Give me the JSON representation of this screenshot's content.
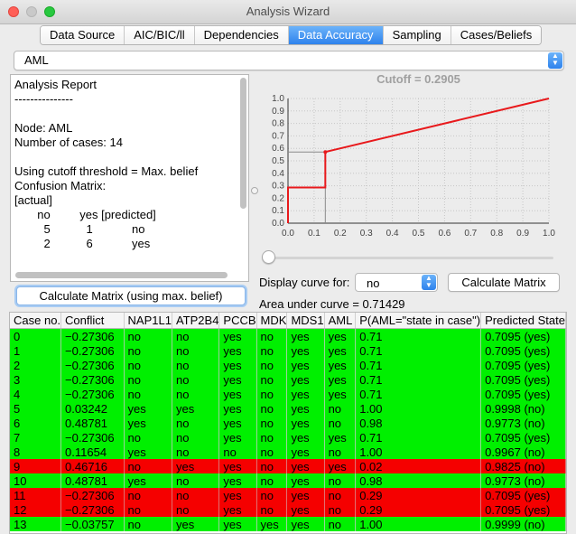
{
  "window": {
    "title": "Analysis Wizard"
  },
  "tabs": [
    {
      "label": "Data Source"
    },
    {
      "label": "AIC/BIC/ll"
    },
    {
      "label": "Dependencies"
    },
    {
      "label": "Data Accuracy",
      "active": true
    },
    {
      "label": "Sampling"
    },
    {
      "label": "Cases/Beliefs"
    }
  ],
  "node_select": {
    "value": "AML"
  },
  "report": {
    "lines": [
      "Analysis Report",
      "---------------",
      "",
      "Node: AML",
      "Number of cases: 14",
      "",
      "Using cutoff threshold = Max. belief",
      "Confusion Matrix:",
      "[actual]",
      "       no         yes [predicted]",
      "         5           1            no",
      "         2           6            yes"
    ]
  },
  "buttons": {
    "calc_max_belief": "Calculate Matrix (using max. belief)",
    "calc_matrix": "Calculate Matrix"
  },
  "chart": {
    "title": "Cutoff = 0.2905"
  },
  "chart_data": {
    "type": "line",
    "title": "Cutoff = 0.2905",
    "xlabel": "",
    "ylabel": "",
    "xlim": [
      0.0,
      1.0
    ],
    "ylim": [
      0.0,
      1.0
    ],
    "x_ticks": [
      "0.0",
      "0.1",
      "0.2",
      "0.3",
      "0.4",
      "0.5",
      "0.6",
      "0.7",
      "0.8",
      "0.9",
      "1.0"
    ],
    "y_ticks": [
      "0.0",
      "0.1",
      "0.2",
      "0.3",
      "0.4",
      "0.5",
      "0.6",
      "0.7",
      "0.8",
      "0.9",
      "1.0"
    ],
    "grid": true,
    "series": [
      {
        "x": [
          0.0,
          0.0,
          0.143,
          0.143,
          1.0
        ],
        "y": [
          0.0,
          0.286,
          0.286,
          0.571,
          1.0
        ]
      }
    ],
    "cutoff_marker": {
      "x": 0.143,
      "y": 0.571
    }
  },
  "slider": {
    "value": 0.0
  },
  "controls": {
    "display_curve_label": "Display curve for:",
    "display_curve_value": "no",
    "auc_label": "Area under curve = 0.71429"
  },
  "table": {
    "columns": [
      "Case no.",
      "Conflict",
      "NAP1L1",
      "ATP2B4",
      "PCCB",
      "MDK",
      "MDS1",
      "AML",
      "P(AML=\"state in case\")",
      "Predicted State"
    ],
    "rows": [
      {
        "cells": [
          "0",
          "−0.27306",
          "no",
          "no",
          "yes",
          "no",
          "yes",
          "yes",
          "0.71",
          "0.7095 (yes)"
        ],
        "status": "green"
      },
      {
        "cells": [
          "1",
          "−0.27306",
          "no",
          "no",
          "yes",
          "no",
          "yes",
          "yes",
          "0.71",
          "0.7095 (yes)"
        ],
        "status": "green"
      },
      {
        "cells": [
          "2",
          "−0.27306",
          "no",
          "no",
          "yes",
          "no",
          "yes",
          "yes",
          "0.71",
          "0.7095 (yes)"
        ],
        "status": "green"
      },
      {
        "cells": [
          "3",
          "−0.27306",
          "no",
          "no",
          "yes",
          "no",
          "yes",
          "yes",
          "0.71",
          "0.7095 (yes)"
        ],
        "status": "green"
      },
      {
        "cells": [
          "4",
          "−0.27306",
          "no",
          "no",
          "yes",
          "no",
          "yes",
          "yes",
          "0.71",
          "0.7095 (yes)"
        ],
        "status": "green"
      },
      {
        "cells": [
          "5",
          "0.03242",
          "yes",
          "yes",
          "yes",
          "no",
          "yes",
          "no",
          "1.00",
          "0.9998 (no)"
        ],
        "status": "green"
      },
      {
        "cells": [
          "6",
          "0.48781",
          "yes",
          "no",
          "yes",
          "no",
          "yes",
          "no",
          "0.98",
          "0.9773 (no)"
        ],
        "status": "green"
      },
      {
        "cells": [
          "7",
          "−0.27306",
          "no",
          "no",
          "yes",
          "no",
          "yes",
          "yes",
          "0.71",
          "0.7095 (yes)"
        ],
        "status": "green"
      },
      {
        "cells": [
          "8",
          "0.11654",
          "yes",
          "no",
          "no",
          "no",
          "yes",
          "no",
          "1.00",
          "0.9967 (no)"
        ],
        "status": "green"
      },
      {
        "cells": [
          "9",
          "0.46716",
          "no",
          "yes",
          "yes",
          "no",
          "yes",
          "yes",
          "0.02",
          "0.9825 (no)"
        ],
        "status": "red"
      },
      {
        "cells": [
          "10",
          "0.48781",
          "yes",
          "no",
          "yes",
          "no",
          "yes",
          "no",
          "0.98",
          "0.9773 (no)"
        ],
        "status": "green"
      },
      {
        "cells": [
          "11",
          "−0.27306",
          "no",
          "no",
          "yes",
          "no",
          "yes",
          "no",
          "0.29",
          "0.7095 (yes)"
        ],
        "status": "red"
      },
      {
        "cells": [
          "12",
          "−0.27306",
          "no",
          "no",
          "yes",
          "no",
          "yes",
          "no",
          "0.29",
          "0.7095 (yes)"
        ],
        "status": "red"
      },
      {
        "cells": [
          "13",
          "−0.03757",
          "no",
          "yes",
          "yes",
          "yes",
          "yes",
          "no",
          "1.00",
          "0.9999 (no)"
        ],
        "status": "green"
      }
    ]
  },
  "colors": {
    "correct_row": "#00f000",
    "wrong_row": "#f50000",
    "curve": "#e8191c",
    "accent": "#2e82ec"
  }
}
